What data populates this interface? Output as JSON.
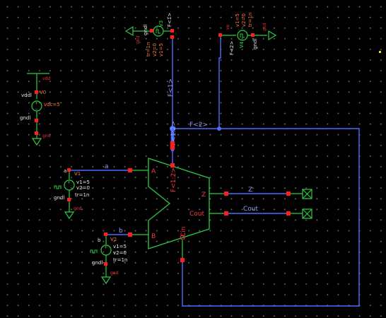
{
  "nets": {
    "bus_top": "F<1>",
    "bus_right": "F<2>",
    "bus_main": "F<1:2>",
    "net_a": "a",
    "net_b": "b",
    "net_z": "Z",
    "net_cout": "Cout"
  },
  "vdd_source": {
    "top_label": "vdd",
    "name": "vddl",
    "value": "vdc=5",
    "ground_name": "gndl",
    "ground_label": "gnd",
    "instance": "V0"
  },
  "pulse_top": {
    "top_label": "F<1>",
    "gnd_name": "gndl",
    "gnd_label": "gnd",
    "instance": "V3",
    "tr": "tr=1n",
    "v1": "v1=5",
    "v2": "v2=0"
  },
  "pulse_right": {
    "top_label": "F<2>",
    "gnd_name": "gndl",
    "gnd_label": "gnd",
    "instance": "V4",
    "tr": "tr=1n",
    "v1": "v1=5",
    "v2": "v2=0"
  },
  "pulse_a": {
    "name": "a",
    "instance": "V1",
    "v1": "v1=5",
    "v2": "v2=0",
    "tr": "tr=1n",
    "ground_name": "gndl",
    "ground_label": "gnd"
  },
  "pulse_b": {
    "name": "b",
    "instance": "V2",
    "v1": "v1=5",
    "v2": "v2=0",
    "tr": "tr=1n",
    "ground_name": "gndl",
    "ground_label": "gnd"
  },
  "alu": {
    "pin_a": "A",
    "pin_b": "B",
    "pin_z": "Z",
    "pin_cout": "Cout",
    "pin_f": "F<1:2>",
    "pin_cin": "Cin"
  }
}
